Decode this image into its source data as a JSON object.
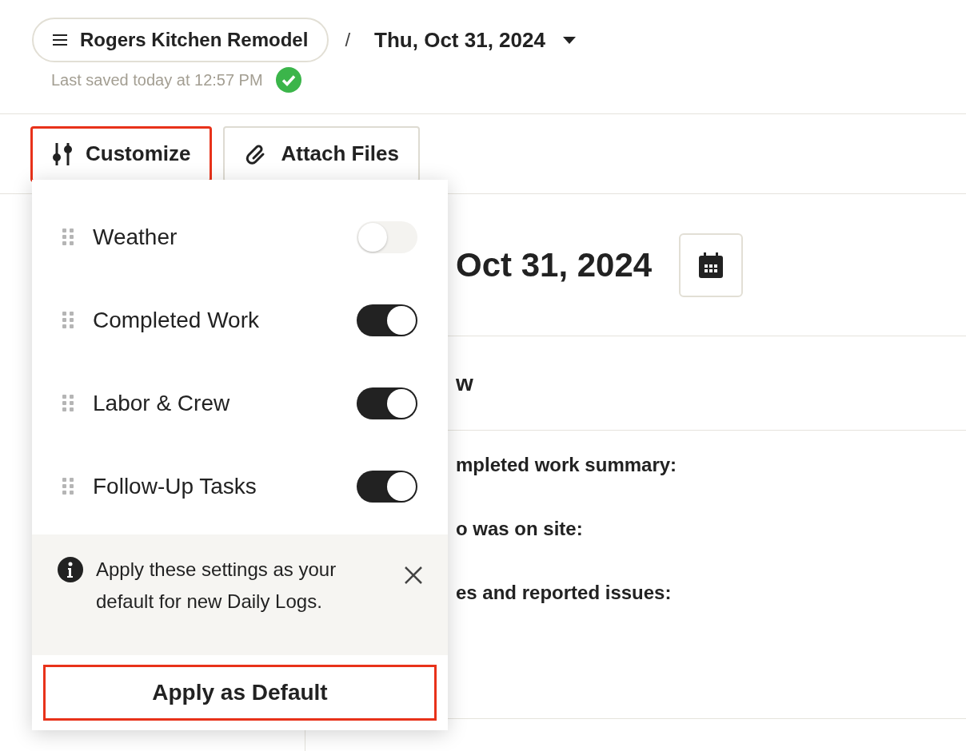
{
  "header": {
    "project_button": "Rogers Kitchen Remodel",
    "separator": "/",
    "date": "Thu, Oct 31, 2024",
    "last_saved": "Last saved today at 12:57 PM",
    "saved": true
  },
  "toolbar": [
    {
      "label": "Customize",
      "highlighted": true
    },
    {
      "label": "Attach Files",
      "highlighted": false
    }
  ],
  "customize_menu": {
    "sections": [
      {
        "label": "Weather",
        "on": false
      },
      {
        "label": "Completed Work",
        "on": true
      },
      {
        "label": "Labor & Crew",
        "on": true
      },
      {
        "label": "Follow-Up Tasks",
        "on": true
      }
    ],
    "notice": "Apply these settings as your default for new Daily Logs.",
    "apply_button": {
      "label": "Apply as Default",
      "highlighted": true
    }
  },
  "log": {
    "date_heading": "Oct 31, 2024",
    "section_title": "w",
    "fields": [
      "mpleted work summary:",
      "o was on site:",
      "es and reported issues:"
    ]
  }
}
